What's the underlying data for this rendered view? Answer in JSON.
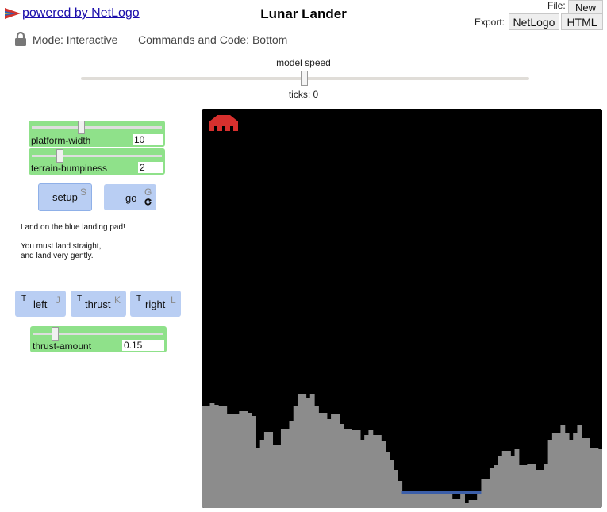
{
  "header": {
    "logo_link": "powered by NetLogo",
    "title": "Lunar Lander",
    "file_label": "File:",
    "new_button": "New",
    "export_label": "Export:",
    "export_netlogo": "NetLogo",
    "export_html": "HTML",
    "mode": "Mode: Interactive",
    "commands": "Commands and Code: Bottom"
  },
  "speed": {
    "label": "model speed",
    "ticks": "ticks: 0"
  },
  "sliders": {
    "platform_width": {
      "name": "platform-width",
      "value": "10"
    },
    "terrain_bumpiness": {
      "name": "terrain-bumpiness",
      "value": "2"
    },
    "thrust_amount": {
      "name": "thrust-amount",
      "value": "0.15"
    }
  },
  "buttons": {
    "setup": {
      "label": "setup",
      "key": "S"
    },
    "go": {
      "label": "go",
      "key": "G"
    },
    "left": {
      "label": "left",
      "key": "J",
      "t": "T"
    },
    "thrust": {
      "label": "thrust",
      "key": "K",
      "t": "T"
    },
    "right": {
      "label": "right",
      "key": "L",
      "t": "T"
    }
  },
  "info": {
    "line1": "Land on the blue landing pad!",
    "line2": "You must land straight,",
    "line3": "and land very gently."
  },
  "world": {
    "background": "#000000",
    "terrain_color": "#8c8c8c",
    "pad_color": "#3b5ea8",
    "lander_color": "#d7302e",
    "terrain_heights": [
      128,
      128,
      132,
      130,
      128,
      128,
      118,
      118,
      118,
      122,
      122,
      120,
      116,
      76,
      86,
      96,
      96,
      80,
      80,
      100,
      100,
      110,
      128,
      144,
      144,
      138,
      144,
      128,
      120,
      120,
      112,
      118,
      118,
      106,
      100,
      100,
      98,
      98,
      86,
      92,
      98,
      92,
      92,
      84,
      70,
      60,
      48,
      34,
      22,
      22,
      22,
      22,
      22,
      22,
      22,
      22,
      22,
      22,
      22,
      22,
      12,
      12,
      22,
      6,
      10,
      10,
      22,
      36,
      36,
      50,
      54,
      66,
      72,
      72,
      66,
      74,
      54,
      54,
      56,
      56,
      48,
      48,
      56,
      86,
      94,
      94,
      104,
      94,
      86,
      94,
      104,
      88,
      88,
      76,
      76,
      74
    ]
  }
}
